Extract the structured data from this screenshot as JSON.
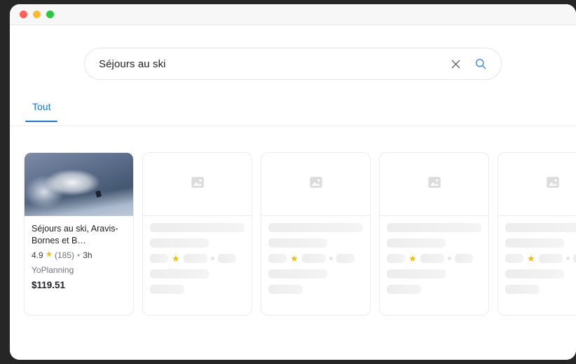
{
  "window": {
    "traffic_lights": [
      "close",
      "minimize",
      "zoom"
    ],
    "colors": {
      "close": "#ff5f57",
      "minimize": "#febc2e",
      "zoom": "#28c840",
      "accent": "#1a73e8",
      "star": "#fabb05"
    }
  },
  "search": {
    "value": "Séjours au ski",
    "placeholder": "",
    "clear_icon": "close-x-icon",
    "search_icon": "search-icon"
  },
  "tabs": [
    {
      "label": "Tout",
      "active": true
    }
  ],
  "results": {
    "cards": [
      {
        "type": "result",
        "title": "Séjours au ski, Aravis-Bornes et B…",
        "rating": "4.9",
        "star": "★",
        "reviews": "(185)",
        "separator": "•",
        "duration": "3h",
        "vendor": "YoPlanning",
        "price": "$119.51",
        "image": "ski-powder-photo"
      },
      {
        "type": "placeholder",
        "image": "image-placeholder-icon",
        "star": "★"
      },
      {
        "type": "placeholder",
        "image": "image-placeholder-icon",
        "star": "★"
      },
      {
        "type": "placeholder",
        "image": "image-placeholder-icon",
        "star": "★"
      },
      {
        "type": "placeholder",
        "image": "image-placeholder-icon",
        "star": "★"
      }
    ]
  }
}
